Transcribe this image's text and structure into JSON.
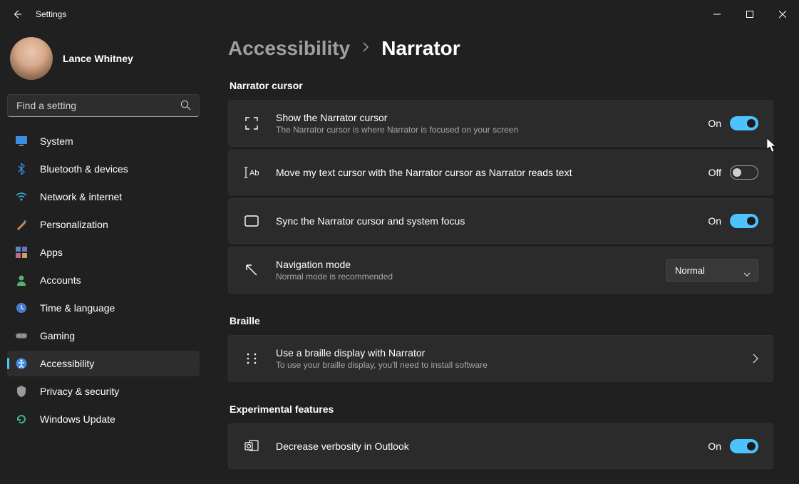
{
  "app": {
    "title": "Settings"
  },
  "user": {
    "name": "Lance Whitney"
  },
  "search": {
    "placeholder": "Find a setting"
  },
  "nav": {
    "items": [
      {
        "label": "System",
        "icon": "system"
      },
      {
        "label": "Bluetooth & devices",
        "icon": "bluetooth"
      },
      {
        "label": "Network & internet",
        "icon": "network"
      },
      {
        "label": "Personalization",
        "icon": "personalization"
      },
      {
        "label": "Apps",
        "icon": "apps"
      },
      {
        "label": "Accounts",
        "icon": "accounts"
      },
      {
        "label": "Time & language",
        "icon": "time"
      },
      {
        "label": "Gaming",
        "icon": "gaming"
      },
      {
        "label": "Accessibility",
        "icon": "accessibility"
      },
      {
        "label": "Privacy & security",
        "icon": "privacy"
      },
      {
        "label": "Windows Update",
        "icon": "update"
      }
    ],
    "active_index": 8
  },
  "breadcrumb": {
    "parent": "Accessibility",
    "current": "Narrator"
  },
  "sections": {
    "narrator_cursor": {
      "heading": "Narrator cursor",
      "items": [
        {
          "title": "Show the Narrator cursor",
          "sub": "The Narrator cursor is where Narrator is focused on your screen",
          "state": "On",
          "on": true
        },
        {
          "title": "Move my text cursor with the Narrator cursor as Narrator reads text",
          "state": "Off",
          "on": false
        },
        {
          "title": "Sync the Narrator cursor and system focus",
          "state": "On",
          "on": true
        },
        {
          "title": "Navigation mode",
          "sub": "Normal mode is recommended",
          "select_value": "Normal"
        }
      ]
    },
    "braille": {
      "heading": "Braille",
      "items": [
        {
          "title": "Use a braille display with Narrator",
          "sub": "To use your braille display, you'll need to install software"
        }
      ]
    },
    "experimental": {
      "heading": "Experimental features",
      "items": [
        {
          "title": "Decrease verbosity in Outlook",
          "state": "On",
          "on": true
        }
      ]
    }
  },
  "colors": {
    "accent": "#4cc2ff"
  }
}
